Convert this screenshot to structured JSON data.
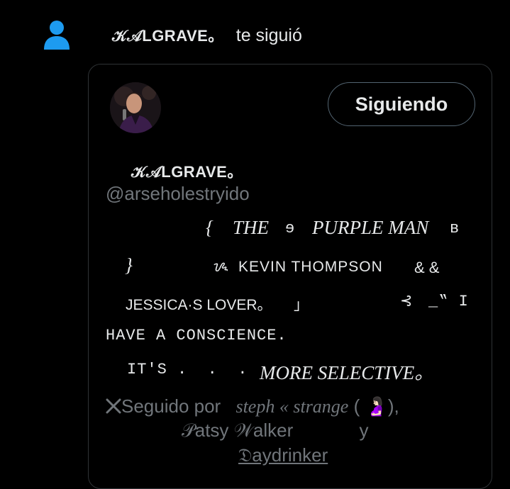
{
  "notification": {
    "icon": "person-icon",
    "accent_color": "#1d9bf0",
    "actor_name": "𝒦𝒜LGRAVE。",
    "action_text": "te siguió"
  },
  "profile_card": {
    "follow_button_label": "Siguiendo",
    "display_name": "𝒦𝒜LGRAVE。",
    "handle": "@arseholestryido",
    "bio": {
      "l1a": "{",
      "l1b": "THE",
      "l1c": "ɘ",
      "l1d": "PURPLE MAN",
      "l1e": "ʙ",
      "l2a": "}",
      "l2b": "ᝰ",
      "l2c": "KEVIN THOMPSON",
      "l2d": "& &",
      "l3a": "JESSICA·S LOVER。",
      "l3b": "」",
      "l3c": "⊰",
      "l3d": "_‟ I",
      "l4": "HAVE A CONSCIENCE.",
      "l5a": "IT'S .  .  .",
      "l5b": "MORE SELECTIVE。"
    },
    "followed_by": {
      "prefix": "Seguido por",
      "name1": "steph « strange",
      "name1_emoji": "( 🤰🏻),",
      "name2": "𝒫atsy 𝒲alker",
      "joiner": "y",
      "name3": "𝔇aydrinker"
    }
  }
}
